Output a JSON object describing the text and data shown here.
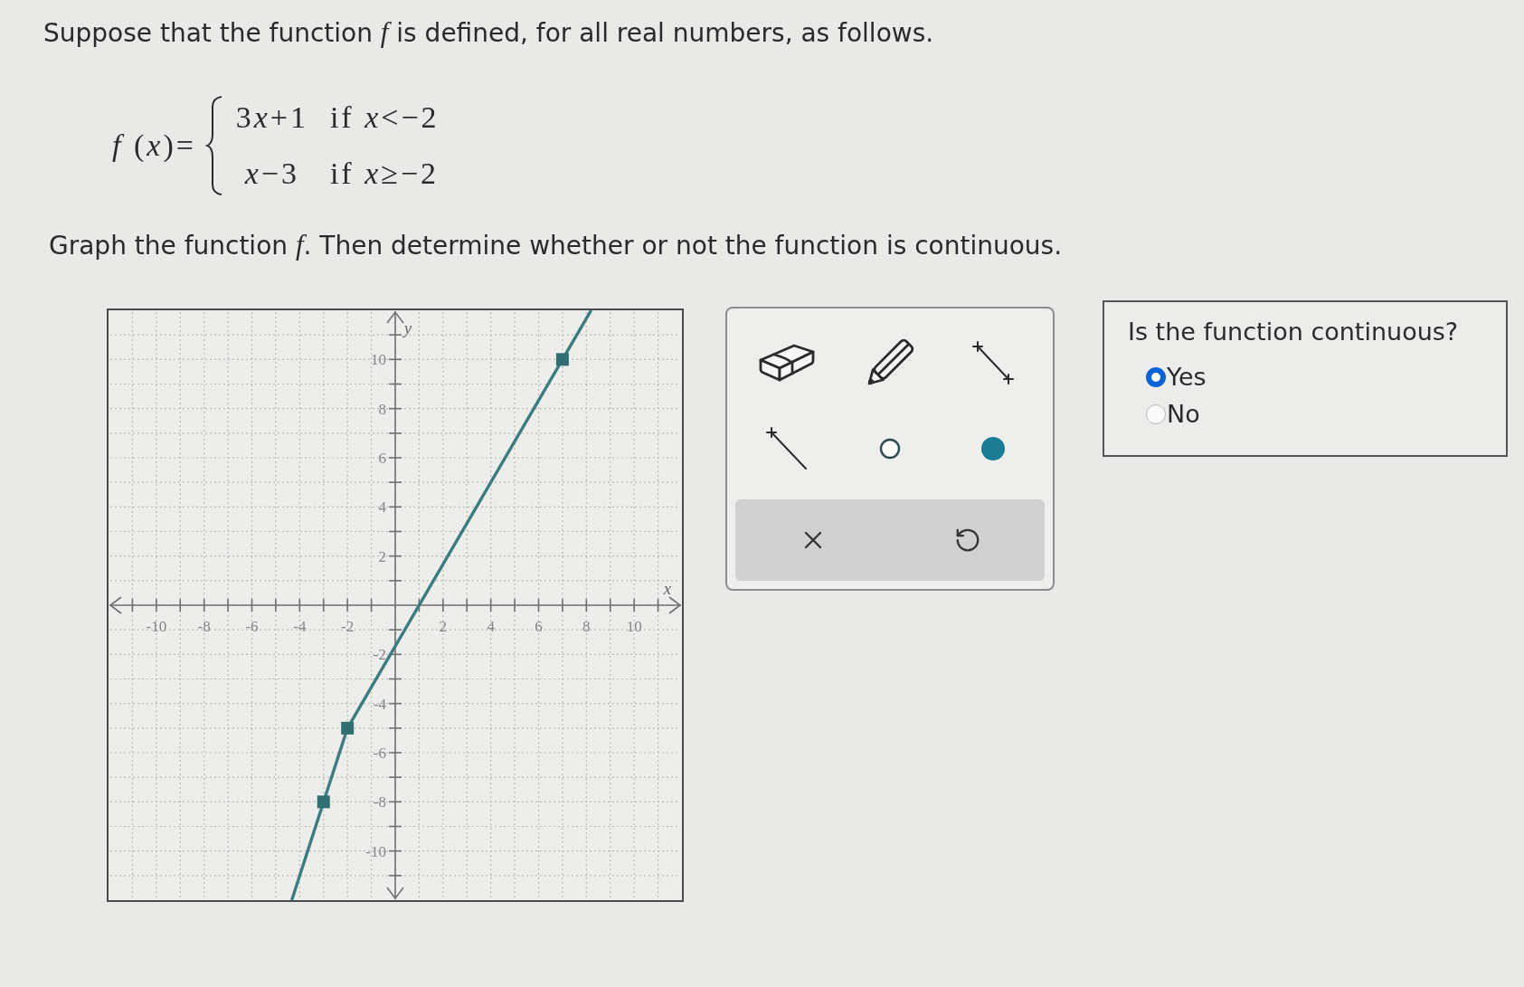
{
  "problem": {
    "intro": "Suppose that the function *f* is defined, for all real numbers, as follows.",
    "formula": {
      "label": "*f* (*x*)=",
      "cases": [
        {
          "expression": [
            "3",
            "*x*",
            "+1"
          ],
          "condition": "if *x*<−2"
        },
        {
          "expression": [
            "*x*",
            "−3"
          ],
          "condition": "if *x*≥−2"
        }
      ]
    },
    "instruction": "Graph the function *f*. Then determine whether or not the function is continuous."
  },
  "graph": {
    "chart_data": [
      {
        "type": "line",
        "xlabel": "x",
        "ylabel": "y",
        "xlim": [
          -12,
          12
        ],
        "ylim": [
          -12,
          12
        ],
        "xticks": [
          -10,
          -8,
          -6,
          -4,
          -2,
          2,
          4,
          6,
          8,
          10
        ],
        "yticks": [
          -10,
          -8,
          -6,
          -4,
          -2,
          2,
          4,
          6,
          8,
          10
        ],
        "grid": true,
        "series": [
          {
            "type": "line",
            "color": "#3a7c7f",
            "x": [
              -4.33,
              -3,
              -2,
              7,
              8.2
            ],
            "values": [
              -12,
              -8,
              -5,
              10,
              12
            ]
          },
          {
            "type": "scatter",
            "marker": "square",
            "color": "#2f6f72",
            "x": [
              -3,
              -2,
              7
            ],
            "values": [
              -8,
              -5,
              10
            ]
          }
        ]
      }
    ]
  },
  "tools": [
    {
      "kind": "eraser"
    },
    {
      "kind": "pencil"
    },
    {
      "kind": "segment"
    },
    {
      "kind": "ray"
    },
    {
      "kind": "open_point"
    },
    {
      "kind": "closed_point"
    }
  ],
  "actions": [
    {
      "kind": "clear"
    },
    {
      "kind": "undo"
    }
  ],
  "question": {
    "prompt": "Is the function continuous?",
    "options": [
      {
        "label": "Yes",
        "selected": true
      },
      {
        "label": "No",
        "selected": false
      }
    ]
  }
}
